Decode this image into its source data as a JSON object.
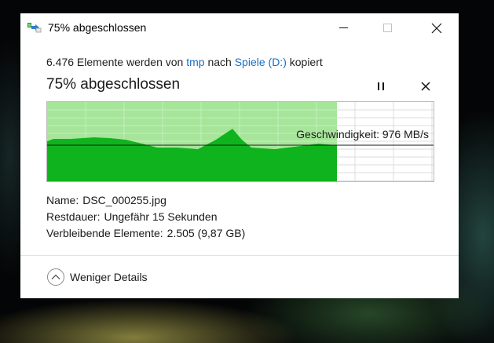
{
  "window": {
    "title": "75% abgeschlossen",
    "icons": {
      "app": "copy-files-icon",
      "minimize": "minimize-icon",
      "maximize": "maximize-icon",
      "close": "close-icon"
    }
  },
  "transfer": {
    "description": {
      "prefix": "6.476 Elemente werden von",
      "source": "tmp",
      "middle": "nach",
      "destination": "Spiele (D:)",
      "suffix": "kopiert"
    },
    "status_title": "75% abgeschlossen",
    "progress_fraction": 0.75,
    "controls": {
      "pause_icon": "pause-icon",
      "cancel_icon": "close-icon"
    }
  },
  "speed_graph": {
    "label": "Geschwindigkeit: 976 MB/s",
    "current_speed_mb_s": 976,
    "colors": {
      "filled": "#0fb31d",
      "progress_bg": "#a6e59a",
      "grid": "#dcdcdc",
      "progress_grid": "#c4efbd",
      "line": "#1a1a1a"
    }
  },
  "details": {
    "name_label": "Name:",
    "name_value": "DSC_000255.jpg",
    "time_label": "Restdauer:",
    "time_value": "Ungefähr 15 Sekunden",
    "remaining_label": "Verbleibende Elemente:",
    "remaining_value": "2.505 (9,87 GB)"
  },
  "footer": {
    "toggle_label": "Weniger Details",
    "toggle_icon": "chevron-up-icon"
  }
}
